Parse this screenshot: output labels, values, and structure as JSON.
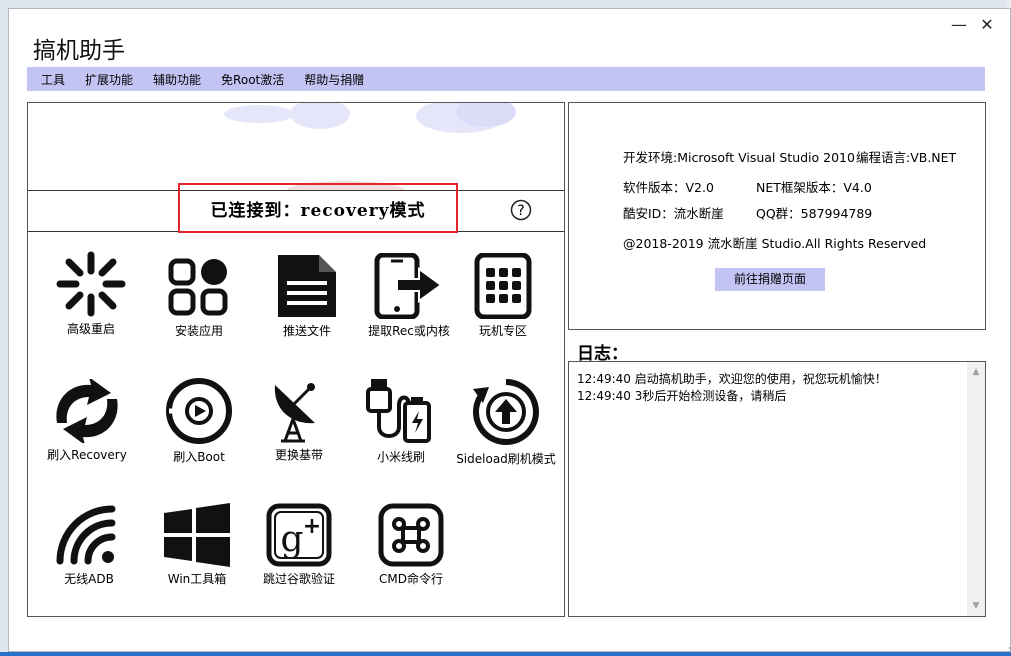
{
  "window": {
    "title": "搞机助手",
    "minimize_glyph": "—",
    "close_glyph": "✕"
  },
  "menu": [
    {
      "label": "工具"
    },
    {
      "label": "扩展功能"
    },
    {
      "label": "辅助功能"
    },
    {
      "label": "免Root激活"
    },
    {
      "label": "帮助与捐赠"
    }
  ],
  "status": {
    "text": "已连接到：recovery模式",
    "help_glyph": "?"
  },
  "tiles": [
    {
      "label": "高级重启",
      "icon": "advanced-reboot-icon"
    },
    {
      "label": "安装应用",
      "icon": "install-app-icon"
    },
    {
      "label": "推送文件",
      "icon": "push-file-icon"
    },
    {
      "label": "提取Rec或内核",
      "icon": "extract-rec-icon"
    },
    {
      "label": "玩机专区",
      "icon": "tablet-icon"
    },
    {
      "label": "刷入Recovery",
      "icon": "flash-recovery-icon"
    },
    {
      "label": "刷入Boot",
      "icon": "flash-boot-icon"
    },
    {
      "label": "更换基带",
      "icon": "satellite-dish-icon"
    },
    {
      "label": "小米线刷",
      "icon": "usb-cable-icon"
    },
    {
      "label": "Sideload刷机模式",
      "icon": "sideload-upload-icon"
    },
    {
      "label": "无线ADB",
      "icon": "wifi-icon"
    },
    {
      "label": "Win工具箱",
      "icon": "windows-icon"
    },
    {
      "label": "跳过谷歌验证",
      "icon": "google-plus-icon"
    },
    {
      "label": "CMD命令行",
      "icon": "command-icon"
    }
  ],
  "info": {
    "dev_env": "开发环境:Microsoft Visual Studio 2010",
    "language": "编程语言:VB.NET",
    "software_version": "软件版本：V2.0",
    "net_version": "NET框架版本：V4.0",
    "coolapk_id": "酷安ID：流水断崖",
    "qq_group": "QQ群：587994789",
    "copyright": "@2018-2019  流水断崖 Studio.All Rights Reserved",
    "donate_button": "前往捐赠页面"
  },
  "log": {
    "heading": "日志：",
    "lines": [
      "12:49:40 启动搞机助手，欢迎您的使用，祝您玩机愉快！",
      "12:49:40 3秒后开始检测设备，请稍后"
    ]
  },
  "colors": {
    "menubar": "#c4c4f4",
    "highlight_border": "#e3242b",
    "taskbar_accent": "#2a71c9"
  }
}
